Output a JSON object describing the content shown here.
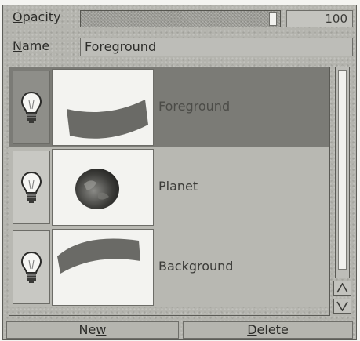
{
  "opacity": {
    "label_first": "O",
    "label_rest": "pacity",
    "value": "100",
    "fraction": 1.0
  },
  "name": {
    "label_first": "N",
    "label_rest": "ame",
    "value": "Foreground"
  },
  "layers": [
    {
      "name": "Foreground",
      "selected": true,
      "icon": "lightbulb-icon",
      "thumbnail": "curved-sheet"
    },
    {
      "name": "Planet",
      "selected": false,
      "icon": "lightbulb-icon",
      "thumbnail": "planet-sphere"
    },
    {
      "name": "Background",
      "selected": false,
      "icon": "lightbulb-icon",
      "thumbnail": "curved-sheet"
    }
  ],
  "scroll": {
    "up_icon": "triangle-up-icon",
    "down_icon": "triangle-down-icon"
  },
  "buttons": {
    "new_pre": "Ne",
    "new_u": "w",
    "delete_pre": "",
    "delete_u": "D",
    "delete_post": "elete"
  },
  "colors": {
    "panel": "#b4b4ae",
    "selected_row": "#7b7b76",
    "thumb_shape": "#6a6a66"
  }
}
